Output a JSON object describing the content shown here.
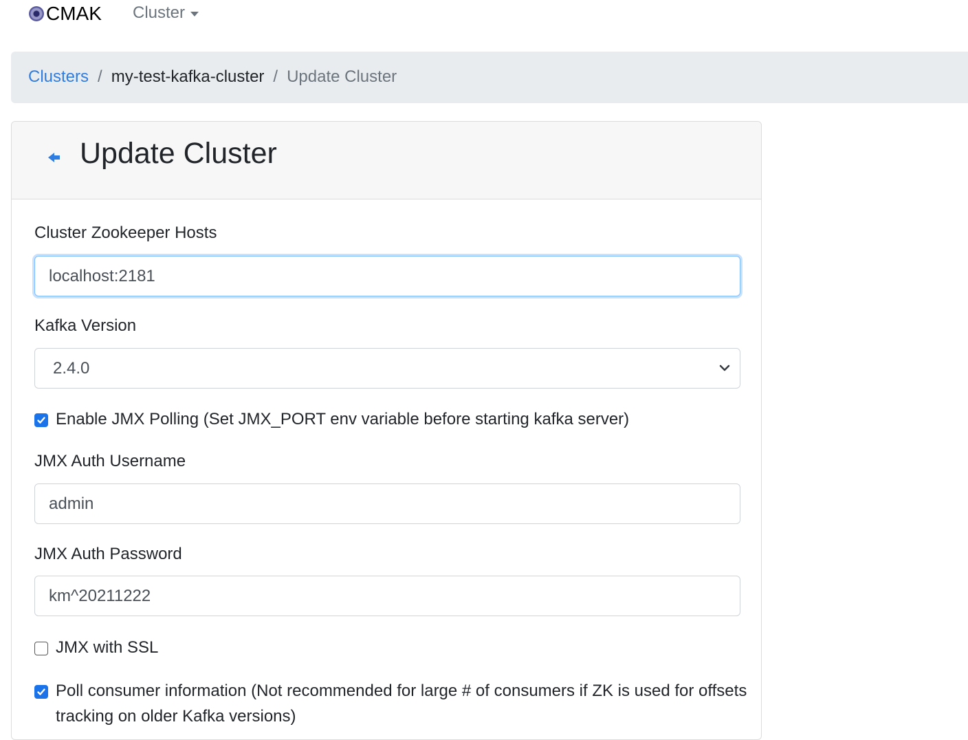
{
  "navbar": {
    "brand": "CMAK",
    "menu_label": "Cluster"
  },
  "breadcrumb": {
    "items": [
      "Clusters",
      "my-test-kafka-cluster",
      "Update Cluster"
    ],
    "separator": "/"
  },
  "card": {
    "title": "Update Cluster"
  },
  "form": {
    "zk_hosts": {
      "label": "Cluster Zookeeper Hosts",
      "value": "localhost:2181"
    },
    "kafka_version": {
      "label": "Kafka Version",
      "selected": "2.4.0"
    },
    "jmx_polling": {
      "label": "Enable JMX Polling (Set JMX_PORT env variable before starting kafka server)",
      "checked": true
    },
    "jmx_username": {
      "label": "JMX Auth Username",
      "value": "admin"
    },
    "jmx_password": {
      "label": "JMX Auth Password",
      "value": "km^20211222"
    },
    "jmx_ssl": {
      "label": "JMX with SSL",
      "checked": false
    },
    "poll_consumer": {
      "label": "Poll consumer information (Not recommended for large # of consumers if ZK is used for offsets tracking on older Kafka versions)",
      "checked": true
    }
  },
  "colors": {
    "link": "#2f7de1",
    "checkbox_checked": "#1a73e8",
    "breadcrumb_bg": "#e9ecef",
    "focus_ring": "#80bdff"
  }
}
